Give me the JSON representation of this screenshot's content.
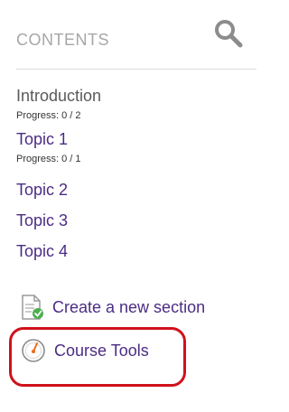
{
  "header": {
    "title": "CONTENTS",
    "search_icon": "search-icon"
  },
  "toc": {
    "introduction": {
      "label": "Introduction",
      "progress": "Progress: 0 / 2"
    },
    "topic1": {
      "label": "Topic 1",
      "progress": "Progress: 0 / 1"
    },
    "topic2": {
      "label": "Topic 2"
    },
    "topic3": {
      "label": "Topic 3"
    },
    "topic4": {
      "label": "Topic 4"
    }
  },
  "actions": {
    "create_section": {
      "label": "Create a new section",
      "icon": "document-add-icon"
    },
    "course_tools": {
      "label": "Course Tools",
      "icon": "gauge-icon"
    }
  },
  "colors": {
    "link": "#4b2c83",
    "muted": "#a7a7a7",
    "highlight": "#d0111b",
    "accent_orange": "#ef6c1a",
    "accent_green": "#4caf50"
  }
}
